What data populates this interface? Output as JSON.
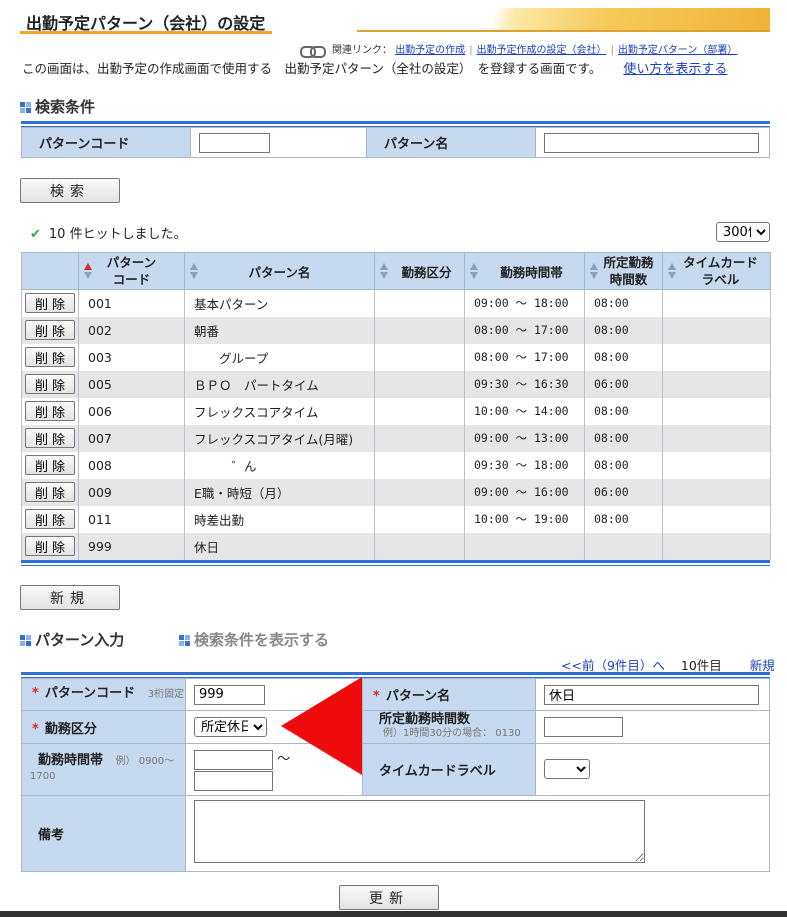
{
  "page": {
    "title": "出勤予定パターン（会社）の設定",
    "related_label": "関連リンク：",
    "related_links": [
      "出勤予定の作成",
      "出勤予定作成の設定（会社）",
      "出勤予定パターン（部署）"
    ],
    "description": "この画面は、出勤予定の作成画面で使用する　出勤予定パターン（全社の設定）　を登録する画面です。",
    "help_link": "使い方を表示する"
  },
  "search": {
    "heading": "検索条件",
    "code_label": "パターンコード",
    "code_value": "",
    "name_label": "パターン名",
    "name_value": "",
    "button": "検索"
  },
  "results": {
    "hit_text": "10 件ヒットしました。",
    "page_size": "300件",
    "headers": {
      "code": [
        "パターン",
        "コード"
      ],
      "name": "パターン名",
      "kubun": "勤務区分",
      "time": "勤務時間帯",
      "hours": [
        "所定勤務",
        "時間数"
      ],
      "label": [
        "タイムカード",
        "ラベル"
      ]
    },
    "delete_label": "削除",
    "rows": [
      {
        "code": "001",
        "name": "基本パターン",
        "kubun": "",
        "time": "09:00 〜 18:00",
        "hours": "08:00",
        "label": ""
      },
      {
        "code": "002",
        "name": "朝番",
        "kubun": "",
        "time": "08:00 〜 17:00",
        "hours": "08:00",
        "label": ""
      },
      {
        "code": "003",
        "name": "　　グループ",
        "kubun": "",
        "time": "08:00 〜 17:00",
        "hours": "08:00",
        "label": ""
      },
      {
        "code": "005",
        "name": "ＢＰＯ　パートタイム",
        "kubun": "",
        "time": "09:30 〜 16:30",
        "hours": "06:00",
        "label": ""
      },
      {
        "code": "006",
        "name": "フレックスコアタイム",
        "kubun": "",
        "time": "10:00 〜 14:00",
        "hours": "08:00",
        "label": ""
      },
      {
        "code": "007",
        "name": "フレックスコアタイム(月曜)",
        "kubun": "",
        "time": "09:00 〜 13:00",
        "hours": "08:00",
        "label": ""
      },
      {
        "code": "008",
        "name": "　　　゛ん",
        "kubun": "",
        "time": "09:30 〜 18:00",
        "hours": "08:00",
        "label": ""
      },
      {
        "code": "009",
        "name": "E職・時短（月）",
        "kubun": "",
        "time": "09:00 〜 16:00",
        "hours": "06:00",
        "label": ""
      },
      {
        "code": "011",
        "name": "時差出勤",
        "kubun": "",
        "time": "10:00 〜 19:00",
        "hours": "08:00",
        "label": ""
      },
      {
        "code": "999",
        "name": "休日",
        "kubun": "",
        "time": "",
        "hours": "",
        "label": ""
      }
    ]
  },
  "new_button": "新規",
  "entry": {
    "heading": "パターン入力",
    "show_search": "検索条件を表示する",
    "nav_prev": "<<前（9件目）へ",
    "nav_current": "10件目",
    "nav_new": "新規",
    "required_mark": "*",
    "code_label": "パターンコード",
    "code_hint": "3桁固定",
    "code_value": "999",
    "name_label": "パターン名",
    "name_value": "休日",
    "kubun_label": "勤務区分",
    "kubun_value": "所定休日",
    "hours_label": "所定勤務時間数",
    "hours_hint": "例）1時間30分の場合： 0130",
    "hours_value": "",
    "time_label": "勤務時間帯",
    "time_hint": "例） 0900〜1700",
    "time_tilde": "〜",
    "time_from": "",
    "time_to": "",
    "timecard_label": "タイムカードラベル",
    "timecard_value": "",
    "memo_label": "備考",
    "memo_value": "",
    "update_button": "更新"
  }
}
